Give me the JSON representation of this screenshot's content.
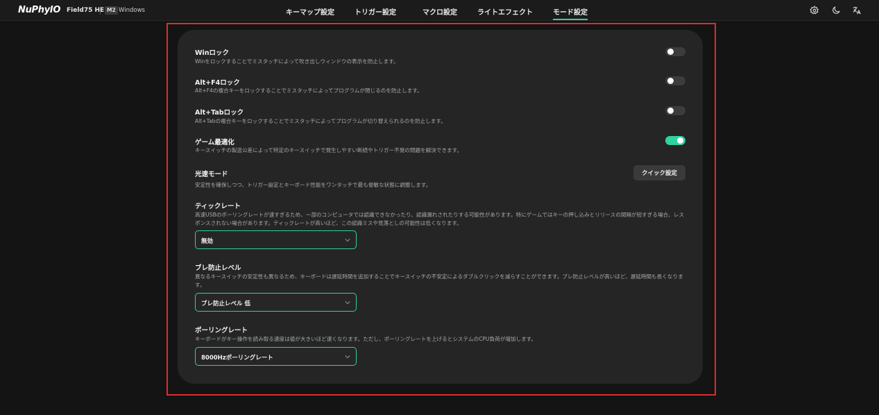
{
  "header": {
    "logo": "NuPhyIO",
    "device": "Field75 HE",
    "mode_badge": "M2",
    "os": "Windows",
    "tabs": [
      {
        "label": "キーマップ設定"
      },
      {
        "label": "トリガー設定"
      },
      {
        "label": "マクロ設定"
      },
      {
        "label": "ライトエフェクト"
      },
      {
        "label": "モード設定",
        "active": true
      }
    ],
    "icons": [
      "gear-icon",
      "moon-icon",
      "translate-icon"
    ]
  },
  "settings": {
    "win_lock": {
      "title": "Winロック",
      "desc": "Winをロックすることでミスタッチによって吹き出しウィンドウの表示を防止します。",
      "enabled": false
    },
    "altf4_lock": {
      "title": "Alt+F4ロック",
      "desc": "Alt+F4の複合キーをロックすることでミスタッチによってプログラムが閉じるのを防止します。",
      "enabled": false
    },
    "alttab_lock": {
      "title": "Alt+Tabロック",
      "desc": "Alt+Tabの複合キーをロックすることでミスタッチによってプログラムが切り替えられるのを防止します。",
      "enabled": false
    },
    "game_opt": {
      "title": "ゲーム最適化",
      "desc": "キースイッチの製造公差によって特定のキースイッチで発生しやすい断続やトリガー不発の問題を解決できます。",
      "enabled": true
    },
    "light_speed": {
      "title": "光速モード",
      "desc": "安定性を確保しつつ、トリガー設定とキーボード性能をワンタッチで最も俊敏な状態に調整します。",
      "button": "クイック設定"
    },
    "tick_rate": {
      "title": "ティックレート",
      "desc": "高速USBのポーリングレートが速すぎるため、一部のコンピュータでは認識できなかったり、認識漏れされたりする可能性があります。特にゲームではキーの押し込みとリリースの間隔が短すぎる場合、レスポンスされない場合があります。ティックレートが高いほど、この認識ミスや見落としの可能性は低くなります。",
      "value": "無効"
    },
    "debounce": {
      "title": "ブレ防止レベル",
      "desc": "異なるキースイッチの安定性も異なるため、キーボードは遅延時間を追加することでキースイッチの不安定によるダブルクリックを減らすことができます。ブレ防止レベルが高いほど、遅延時間も長くなります。",
      "value": "ブレ防止レベル 低"
    },
    "polling": {
      "title": "ポーリングレート",
      "desc": "キーボードがキー操作を読み取る速度は値が大きいほど速くなります。ただし、ポーリングレートを上げるとシステムのCPU負荷が増加します。",
      "value": "8000Hzポーリングレート"
    }
  },
  "colors": {
    "accent": "#2fd3a0",
    "highlight_frame": "#e02c2c",
    "background": "#141414",
    "card": "#252525"
  }
}
